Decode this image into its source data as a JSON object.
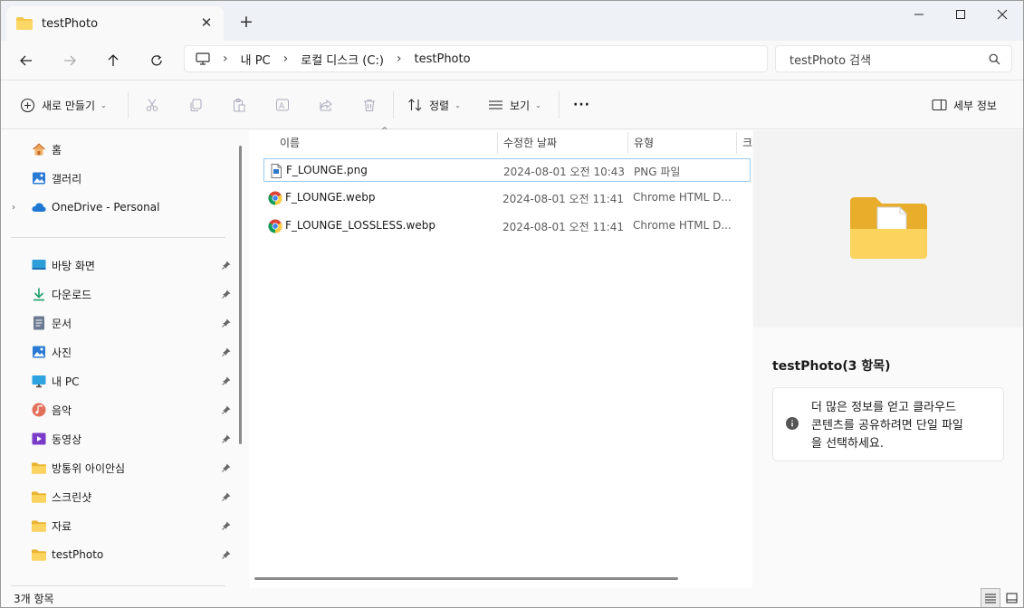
{
  "window": {
    "tab_title": "testPhoto"
  },
  "address": {
    "crumbs": [
      "내 PC",
      "로컬 디스크 (C:)",
      "testPhoto"
    ]
  },
  "search": {
    "placeholder": "testPhoto 검색"
  },
  "toolbar": {
    "new_label": "새로 만들기",
    "sort_label": "정렬",
    "view_label": "보기",
    "more_label": "···",
    "details_label": "세부 정보"
  },
  "nav": {
    "top_items": [
      {
        "label": "홈",
        "icon": "home-icon"
      },
      {
        "label": "갤러리",
        "icon": "gallery-icon"
      },
      {
        "label": "OneDrive - Personal",
        "icon": "cloud-icon"
      }
    ],
    "quick_items": [
      {
        "label": "바탕 화면",
        "icon": "desktop-icon"
      },
      {
        "label": "다운로드",
        "icon": "download-icon"
      },
      {
        "label": "문서",
        "icon": "document-icon"
      },
      {
        "label": "사진",
        "icon": "pictures-icon"
      },
      {
        "label": "내 PC",
        "icon": "pc-icon"
      },
      {
        "label": "음악",
        "icon": "music-icon"
      },
      {
        "label": "동영상",
        "icon": "video-icon"
      },
      {
        "label": "방통위 아이안심",
        "icon": "folder-icon"
      },
      {
        "label": "스크린샷",
        "icon": "folder-icon"
      },
      {
        "label": "자료",
        "icon": "folder-icon"
      },
      {
        "label": "testPhoto",
        "icon": "folder-icon"
      }
    ]
  },
  "files": {
    "columns": [
      "이름",
      "수정한 날짜",
      "유형",
      "크"
    ],
    "rows": [
      {
        "name": "F_LOUNGE.png",
        "date": "2024-08-01 오전 10:43",
        "type": "PNG 파일",
        "icon": "png-file-icon"
      },
      {
        "name": "F_LOUNGE.webp",
        "date": "2024-08-01 오전 11:41",
        "type": "Chrome HTML D...",
        "icon": "chrome-icon"
      },
      {
        "name": "F_LOUNGE_LOSSLESS.webp",
        "date": "2024-08-01 오전 11:41",
        "type": "Chrome HTML D...",
        "icon": "chrome-icon"
      }
    ]
  },
  "details": {
    "title": "testPhoto(3 항목)",
    "info_line1": "더 많은 정보를 얻고 클라우드",
    "info_line2": "콘텐츠를 공유하려면 단일 파일",
    "info_line3": "을 선택하세요."
  },
  "status": {
    "count": "3개 항목"
  },
  "colors": {
    "folder": "#f5c84c",
    "accent": "#0067c0",
    "selection_border": "#99c9ef"
  }
}
